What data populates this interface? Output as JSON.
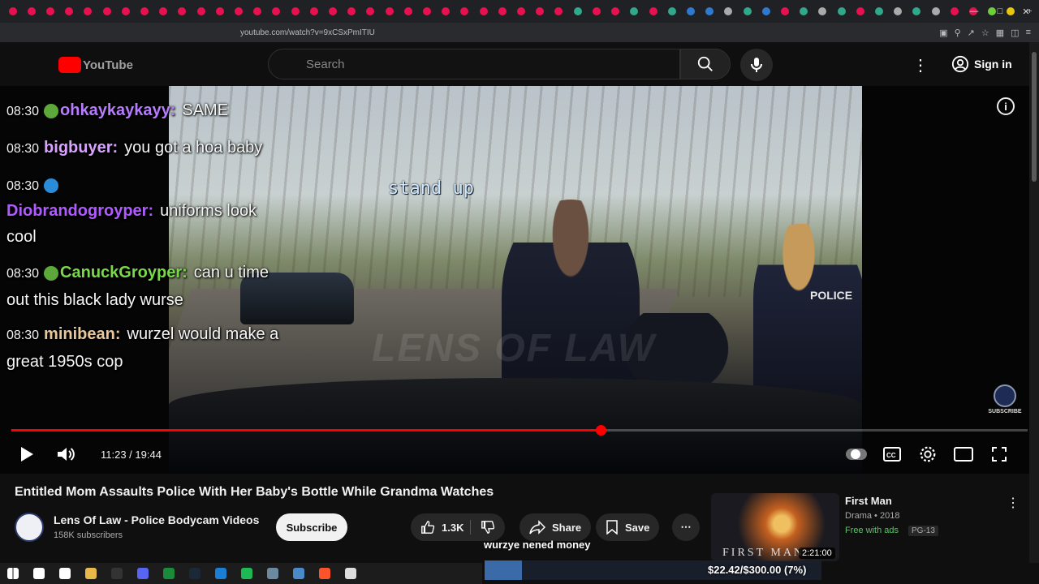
{
  "browser": {
    "url": "youtube.com/watch?v=9xCSxPmITIU",
    "tab_colors": [
      "#e8114f",
      "#e8114f",
      "#e8114f",
      "#e8114f",
      "#e8114f",
      "#e8114f",
      "#e8114f",
      "#e8114f",
      "#e8114f",
      "#e8114f",
      "#e8114f",
      "#e8114f",
      "#e8114f",
      "#e8114f",
      "#e8114f",
      "#e8114f",
      "#e8114f",
      "#e8114f",
      "#e8114f",
      "#e8114f",
      "#e8114f",
      "#e8114f",
      "#e8114f",
      "#e8114f",
      "#e8114f",
      "#e8114f",
      "#e8114f",
      "#e8114f",
      "#e8114f",
      "#e8114f",
      "#2fa88b",
      "#e8114f",
      "#e8114f",
      "#2fa88b",
      "#e8114f",
      "#2fa88b",
      "#2f7ad1",
      "#2f7ad1",
      "#aaaaaa",
      "#2fa88b",
      "#2f7ad1",
      "#e8114f",
      "#2fa88b",
      "#aaaaaa",
      "#2fa88b",
      "#e8114f",
      "#2fa88b",
      "#aaaaaa",
      "#2fa88b",
      "#aaaaaa",
      "#e8114f",
      "#e8114f",
      "#6fcf3a",
      "#e8c60e"
    ],
    "new_tab_label": "+"
  },
  "youtube": {
    "logo_text": "YouTube",
    "search_placeholder": "Search",
    "sign_in": "Sign in"
  },
  "player": {
    "caption": "stand up",
    "watermark": "LENS OF LAW",
    "police_label": "POLICE",
    "subscribe_watermark": "SUBSCRIBE",
    "time": "11:23 / 19:44",
    "progress_fraction": 0.5797,
    "accent": "#ff0000"
  },
  "chat": [
    {
      "ts": "08:30",
      "user": "ohkaykaykayy",
      "user_color": "#b77bff",
      "msg": "SAME",
      "emote_color": "#5ca83a"
    },
    {
      "ts": "08:30",
      "user": "bigbuyer",
      "user_color": "#d9a2ff",
      "msg": "you got a hoa baby",
      "emote_color": ""
    },
    {
      "ts": "08:30",
      "user": "",
      "user_color": "#ffffff",
      "msg": "",
      "emote_color": "#2a8cd8"
    },
    {
      "ts": "",
      "user": "Diobrandogroyper",
      "user_color": "#b05bff",
      "msg": "uniforms look",
      "emote_color": ""
    },
    {
      "ts": "",
      "user": "",
      "user_color": "#ffffff",
      "msg": "cool",
      "emote_color": ""
    },
    {
      "ts": "08:30",
      "user": "CanuckGroyper",
      "user_color": "#79d94a",
      "msg": "can u time",
      "emote_color": "#5ca83a"
    },
    {
      "ts": "",
      "user": "",
      "user_color": "#ffffff",
      "msg": "out this black lady wurse",
      "emote_color": ""
    },
    {
      "ts": "08:30",
      "user": "minibean",
      "user_color": "#e8c79b",
      "msg": "wurzel would make a",
      "emote_color": ""
    },
    {
      "ts": "",
      "user": "",
      "user_color": "#ffffff",
      "msg": "great 1950s cop",
      "emote_color": ""
    }
  ],
  "video": {
    "title": "Entitled Mom Assaults Police With Her Baby's Bottle While Grandma Watches",
    "channel": "Lens Of Law - Police Bodycam Videos",
    "subscribers": "158K subscribers",
    "subscribe_label": "Subscribe",
    "likes": "1.3K",
    "share_label": "Share",
    "save_label": "Save"
  },
  "recommended": {
    "title": "First Man",
    "meta": "Drama • 2018",
    "free": "Free with ads",
    "rating": "PG-13",
    "duration": "2:21:00",
    "thumb_text": "FIRST MAN"
  },
  "overlay": {
    "goal_label": "wurzye nened money",
    "goal_amount": "$22.42/$300.00 (7%)",
    "goal_fraction": 0.07
  },
  "taskbar": {
    "icons": [
      "windows-start",
      "search",
      "task-view",
      "file-explorer",
      "obs",
      "discord",
      "chrome",
      "steam",
      "edge",
      "spotify",
      "app",
      "app2",
      "brave",
      "app3"
    ]
  }
}
